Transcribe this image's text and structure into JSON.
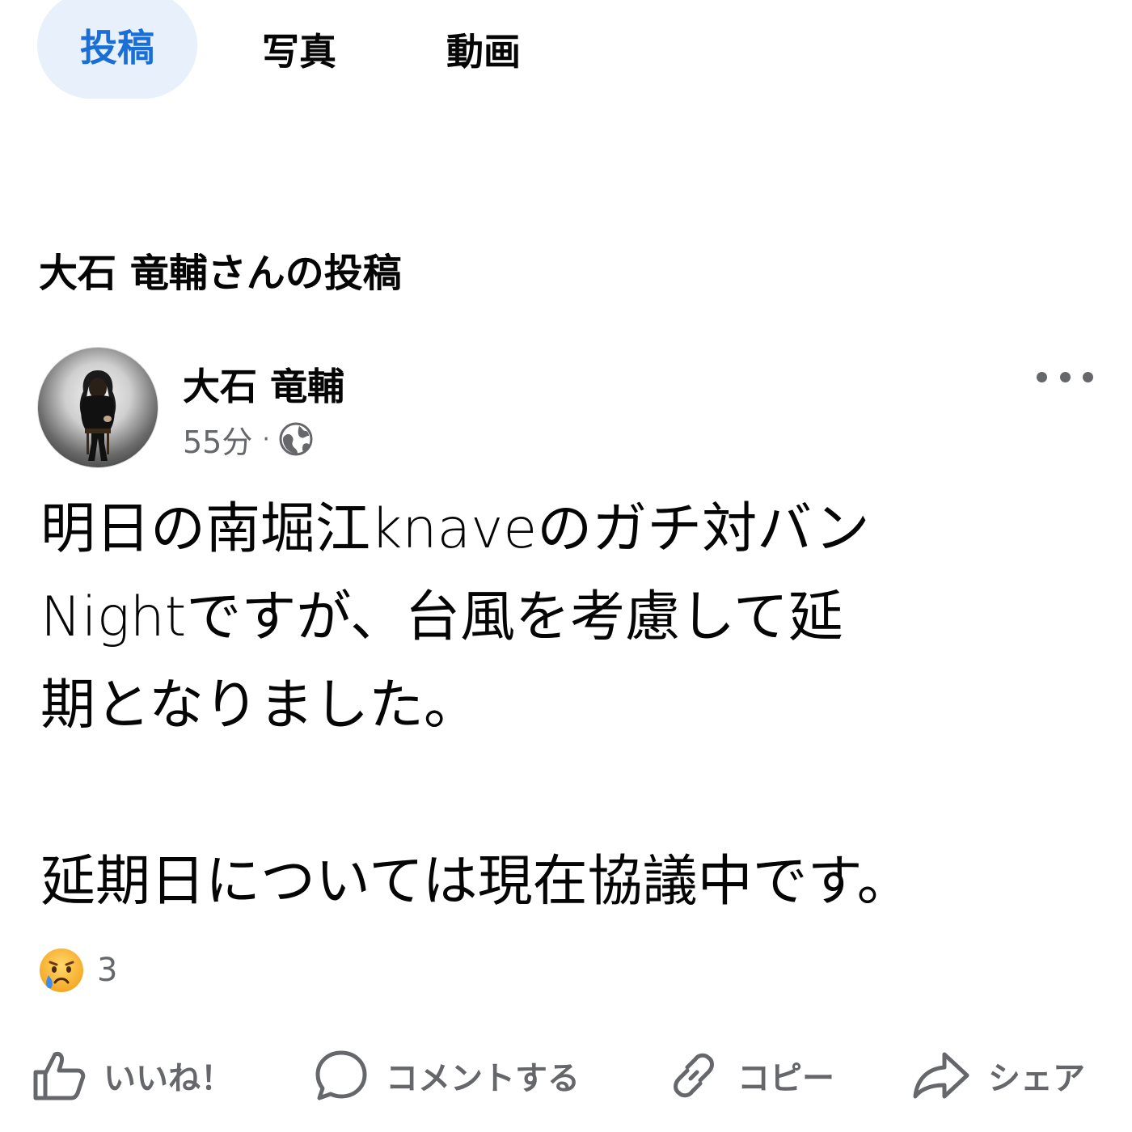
{
  "tabs": [
    {
      "label": "投稿",
      "active": true
    },
    {
      "label": "写真",
      "active": false
    },
    {
      "label": "動画",
      "active": false
    }
  ],
  "section_title": "大石 竜輔さんの投稿",
  "post": {
    "author": "大石 竜輔",
    "time": "55分",
    "separator": "·",
    "privacy_icon": "globe-icon",
    "body_lines": [
      "明日の南堀江knaveのガチ対バン",
      "Nightですが、台風を考慮して延",
      "期となりました。",
      "延期日については現在協議中です。"
    ],
    "reaction_icon": "crying-face-icon",
    "reaction_count": "3"
  },
  "actions": {
    "like": "いいね！",
    "comment": "コメントする",
    "copy": "コピー",
    "share": "シェア"
  },
  "colors": {
    "active_tab_bg": "#e7f0fb",
    "active_tab_text": "#1a6ed8",
    "secondary_text": "#65676b",
    "primary_text": "#050505"
  }
}
